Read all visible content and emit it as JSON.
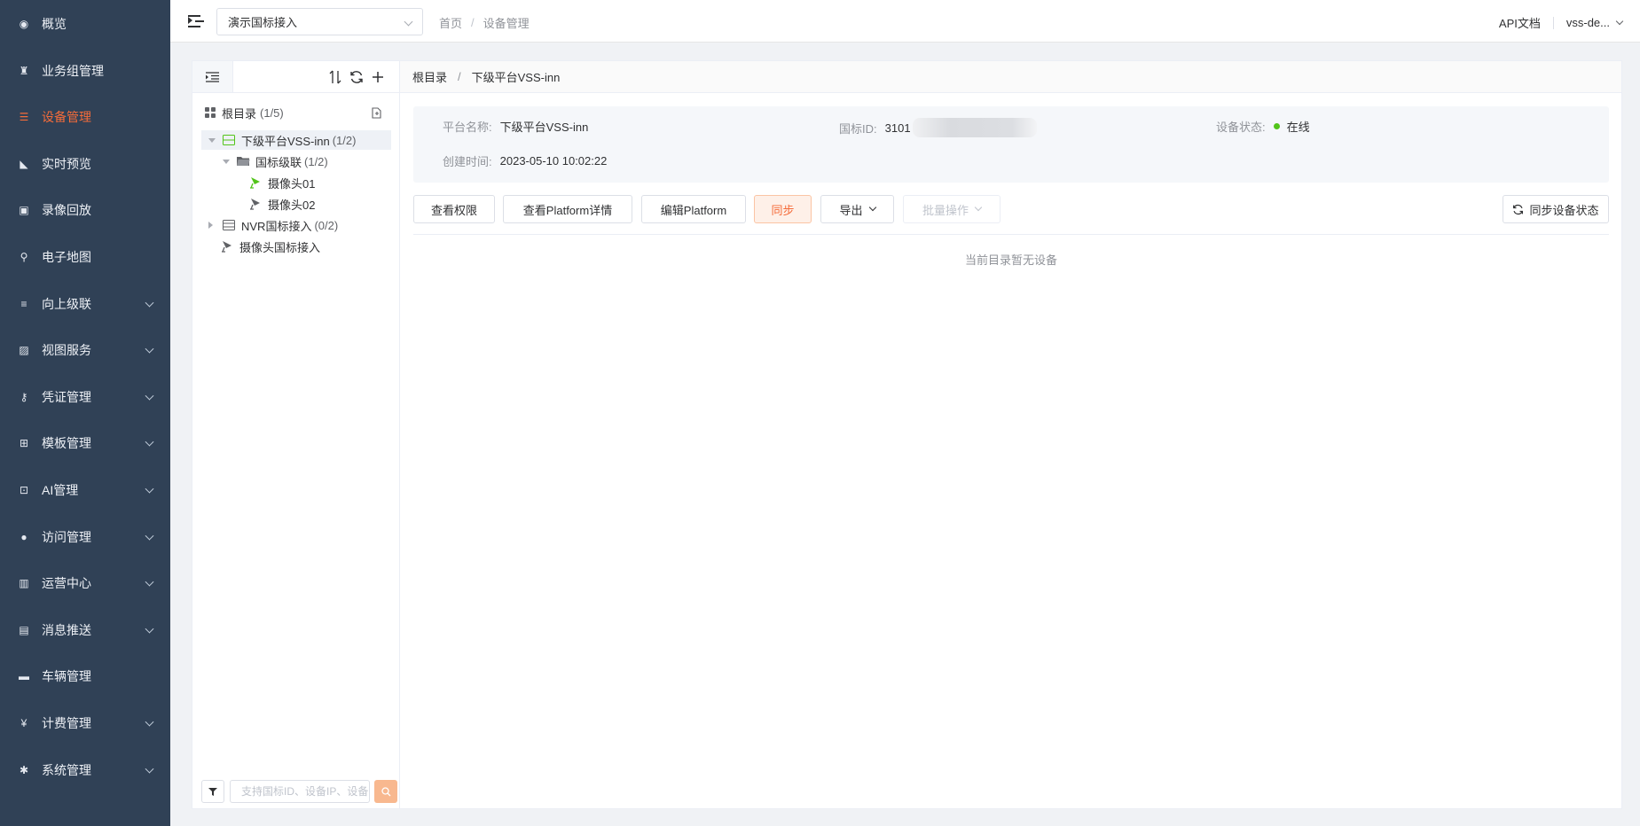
{
  "sidebar": {
    "items": [
      {
        "label": "概览",
        "icon": "dashboard-icon",
        "has_children": false,
        "active": false
      },
      {
        "label": "业务组管理",
        "icon": "business-group-icon",
        "has_children": false,
        "active": false
      },
      {
        "label": "设备管理",
        "icon": "device-list-icon",
        "has_children": false,
        "active": true
      },
      {
        "label": "实时预览",
        "icon": "camera-icon",
        "has_children": false,
        "active": false
      },
      {
        "label": "录像回放",
        "icon": "video-playback-icon",
        "has_children": false,
        "active": false
      },
      {
        "label": "电子地图",
        "icon": "map-pin-icon",
        "has_children": false,
        "active": false
      },
      {
        "label": "向上级联",
        "icon": "cascade-icon",
        "has_children": true,
        "active": false
      },
      {
        "label": "视图服务",
        "icon": "image-icon",
        "has_children": true,
        "active": false
      },
      {
        "label": "凭证管理",
        "icon": "key-icon",
        "has_children": true,
        "active": false
      },
      {
        "label": "模板管理",
        "icon": "template-icon",
        "has_children": true,
        "active": false
      },
      {
        "label": "AI管理",
        "icon": "ai-icon",
        "has_children": true,
        "active": false
      },
      {
        "label": "访问管理",
        "icon": "user-icon",
        "has_children": true,
        "active": false
      },
      {
        "label": "运营中心",
        "icon": "building-icon",
        "has_children": true,
        "active": false
      },
      {
        "label": "消息推送",
        "icon": "inbox-icon",
        "has_children": true,
        "active": false
      },
      {
        "label": "车辆管理",
        "icon": "car-icon",
        "has_children": false,
        "active": false
      },
      {
        "label": "计费管理",
        "icon": "billing-icon",
        "has_children": true,
        "active": false
      },
      {
        "label": "系统管理",
        "icon": "gear-icon",
        "has_children": true,
        "active": false
      }
    ],
    "active_color": "#f56c3a",
    "background": "#304156"
  },
  "header": {
    "project_select": "演示国标接入",
    "breadcrumb": [
      "首页",
      "设备管理"
    ],
    "api_docs": "API文档",
    "user": "vss-de..."
  },
  "tree": {
    "root": {
      "label": "根目录",
      "count": "(1/5)"
    },
    "nodes": [
      {
        "label": "下级平台VSS-inn",
        "count": "(1/2)",
        "icon": "platform-icon",
        "expanded": true,
        "selected": true
      },
      {
        "label": "国标级联",
        "count": "(1/2)",
        "icon": "folder-icon",
        "expanded": true
      },
      {
        "label": "摄像头01",
        "count": "",
        "icon": "camera-online-icon"
      },
      {
        "label": "摄像头02",
        "count": "",
        "icon": "camera-icon"
      },
      {
        "label": "NVR国标接入",
        "count": "(0/2)",
        "icon": "nvr-icon",
        "expanded": false
      },
      {
        "label": "摄像头国标接入",
        "count": "",
        "icon": "camera-icon"
      }
    ],
    "search_placeholder": "支持国标ID、设备IP、设备名称"
  },
  "content": {
    "breadcrumb": [
      "根目录",
      "下级平台VSS-inn"
    ],
    "info": {
      "platform_name_label": "平台名称:",
      "platform_name": "下级平台VSS-inn",
      "gb_id_label": "国标ID:",
      "gb_id": "3101",
      "status_label": "设备状态:",
      "status": "在线",
      "status_color": "#52c41a",
      "created_label": "创建时间:",
      "created": "2023-05-10 10:02:22"
    },
    "buttons": {
      "view_permission": "查看权限",
      "view_detail": "查看Platform详情",
      "edit": "编辑Platform",
      "sync": "同步",
      "export": "导出",
      "batch": "批量操作",
      "sync_status": "同步设备状态"
    },
    "empty_text": "当前目录暂无设备"
  }
}
